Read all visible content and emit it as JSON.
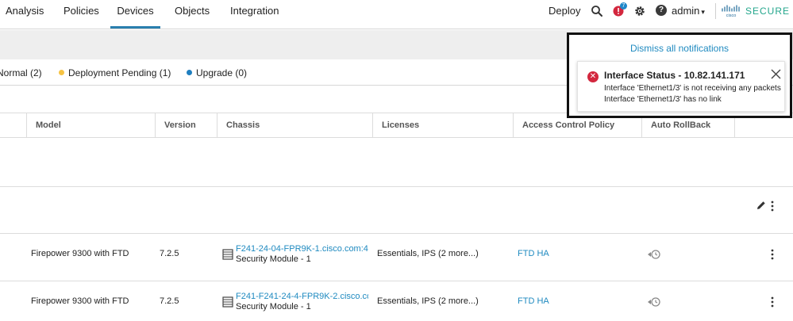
{
  "nav": {
    "tabs": [
      {
        "label": "Analysis"
      },
      {
        "label": "Policies"
      },
      {
        "label": "Devices",
        "active": true
      },
      {
        "label": "Objects"
      },
      {
        "label": "Integration"
      }
    ],
    "deploy_label": "Deploy",
    "alert_count": "7",
    "user_label": "admin",
    "user_caret": "▾",
    "help_glyph": "?",
    "brand": {
      "logo_text": "cisco",
      "product": "SECURE",
      "color": "#23a68c"
    }
  },
  "status_filters": [
    {
      "label": "Normal (2)",
      "color": ""
    },
    {
      "label": "Deployment Pending (1)",
      "color": "#f6c343"
    },
    {
      "label": "Upgrade (0)",
      "color": "#1f7fc0"
    }
  ],
  "table": {
    "columns": [
      "Model",
      "Version",
      "Chassis",
      "Licenses",
      "Access Control Policy",
      "Auto RollBack"
    ],
    "rows": [
      {
        "model": "Firepower 9300 with FTD",
        "version": "7.2.5",
        "chassis_link": "F241-24-04-FPR9K-1.cisco.com:4",
        "chassis_sub": "Security Module - 1",
        "licenses": "Essentials, IPS (2 more...)",
        "acp": "FTD HA"
      },
      {
        "model": "Firepower 9300 with FTD",
        "version": "7.2.5",
        "chassis_link": "F241-F241-24-4-FPR9K-2.cisco.co",
        "chassis_sub": "Security Module - 1",
        "licenses": "Essentials, IPS (2 more...)",
        "acp": "FTD HA"
      }
    ]
  },
  "notifications": {
    "dismiss_all_label": "Dismiss all notifications",
    "items": [
      {
        "severity": "error",
        "title": "Interface Status - 10.82.141.171",
        "lines": [
          "Interface 'Ethernet1/3' is not receiving any packets",
          "Interface 'Ethernet1/3' has no link"
        ],
        "error_glyph": "✕"
      }
    ]
  },
  "colors": {
    "accent": "#2a7fae",
    "link": "#1f8ac0",
    "error": "#d3273e"
  }
}
